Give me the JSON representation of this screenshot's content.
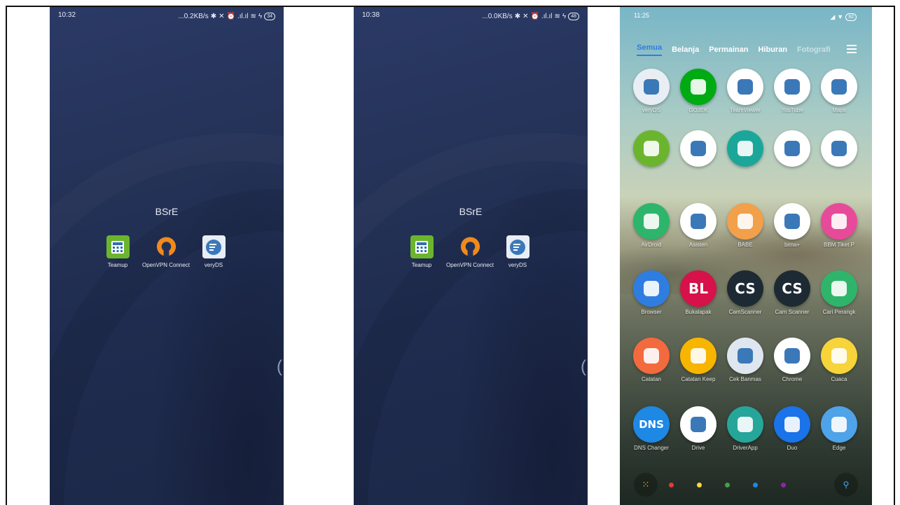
{
  "panel1": {
    "status_time": "10:32",
    "status_net": "...0.2KB/s",
    "status_battery": "34",
    "folder_title": "BSrE",
    "apps": [
      {
        "label": "Teamup",
        "icon": "calculator-icon"
      },
      {
        "label": "OpenVPN Connect",
        "icon": "openvpn-icon"
      },
      {
        "label": "veryDS",
        "icon": "veryds-icon"
      }
    ],
    "edge_handle": "("
  },
  "panel2": {
    "status_time": "10:38",
    "status_net": "...0.0KB/s",
    "status_battery": "48",
    "folder_title": "BSrE",
    "apps": [
      {
        "label": "Teamup",
        "icon": "calculator-icon"
      },
      {
        "label": "OpenVPN Connect",
        "icon": "openvpn-icon"
      },
      {
        "label": "veryDS",
        "icon": "veryds-icon"
      }
    ],
    "edge_handle": "("
  },
  "panel3": {
    "status_time": "11:25",
    "status_battery": "92",
    "tabs": [
      "Semua",
      "Belanja",
      "Permainan",
      "Hiburan",
      "Fotografi"
    ],
    "apps": [
      {
        "label": "veryDS",
        "icon": "veryds-icon",
        "color": "#e9eef5",
        "text": ""
      },
      {
        "label": "GOJEK",
        "icon": "gojek-icon",
        "color": "#00aa13",
        "text": ""
      },
      {
        "label": "TeamViewer",
        "icon": "teamviewer-icon",
        "color": "#ffffff",
        "text": ""
      },
      {
        "label": "YouTube",
        "icon": "youtube-icon",
        "color": "#ffffff",
        "text": ""
      },
      {
        "label": "Maps",
        "icon": "maps-icon",
        "color": "#ffffff",
        "text": ""
      },
      {
        "label": "",
        "icon": "calculator-icon",
        "color": "#6bb52e",
        "text": ""
      },
      {
        "label": "",
        "icon": "play-store-icon",
        "color": "#ffffff",
        "text": ""
      },
      {
        "label": "",
        "icon": "download-icon",
        "color": "#1aa79a",
        "text": ""
      },
      {
        "label": "",
        "icon": "play-books-icon",
        "color": "#ffffff",
        "text": ""
      },
      {
        "label": "",
        "icon": "pdf-icon",
        "color": "#ffffff",
        "text": ""
      },
      {
        "label": "AirDroid",
        "icon": "airdroid-icon",
        "color": "#2db56b",
        "text": ""
      },
      {
        "label": "Asisten",
        "icon": "assistant-icon",
        "color": "#ffffff",
        "text": ""
      },
      {
        "label": "BABE",
        "icon": "babe-icon",
        "color": "#f2a04a",
        "text": ""
      },
      {
        "label": "bima+",
        "icon": "incognito-icon",
        "color": "#ffffff",
        "text": ""
      },
      {
        "label": "BBM Tiket P",
        "icon": "flash-icon",
        "color": "#e84a9a",
        "text": ""
      },
      {
        "label": "Browser",
        "icon": "globe-icon",
        "color": "#2f7de0",
        "text": ""
      },
      {
        "label": "Bukalapak",
        "icon": "bukalapak-icon",
        "color": "#d71149",
        "text": "BL"
      },
      {
        "label": "CamScanner",
        "icon": "camscanner-icon",
        "color": "#1d2a33",
        "text": "CS"
      },
      {
        "label": "Cam Scanner",
        "icon": "camscanner-icon",
        "color": "#1d2a33",
        "text": "CS"
      },
      {
        "label": "Cari Perangk",
        "icon": "find-device-icon",
        "color": "#2fb56b",
        "text": ""
      },
      {
        "label": "Catatan",
        "icon": "notes-icon",
        "color": "#f26a3d",
        "text": ""
      },
      {
        "label": "Catatan Keep",
        "icon": "keep-icon",
        "color": "#f7b500",
        "text": ""
      },
      {
        "label": "Cek Banmas",
        "icon": "emblem-icon",
        "color": "#dfe6ef",
        "text": ""
      },
      {
        "label": "Chrome",
        "icon": "chrome-icon",
        "color": "#ffffff",
        "text": ""
      },
      {
        "label": "Cuaca",
        "icon": "sun-icon",
        "color": "#f6d43a",
        "text": ""
      },
      {
        "label": "DNS Changer",
        "icon": "dns-icon",
        "color": "#1e88e5",
        "text": "DNS"
      },
      {
        "label": "Drive",
        "icon": "drive-icon",
        "color": "#ffffff",
        "text": ""
      },
      {
        "label": "DriverApp",
        "icon": "android-icon",
        "color": "#26a69a",
        "text": ""
      },
      {
        "label": "Duo",
        "icon": "duo-icon",
        "color": "#1a73e8",
        "text": ""
      },
      {
        "label": "Edge",
        "icon": "wave-icon",
        "color": "#4fa3e8",
        "text": ""
      }
    ],
    "dock_dots": [
      "#e53935",
      "#fdd835",
      "#43a047",
      "#1e88e5",
      "#8e24aa"
    ]
  }
}
